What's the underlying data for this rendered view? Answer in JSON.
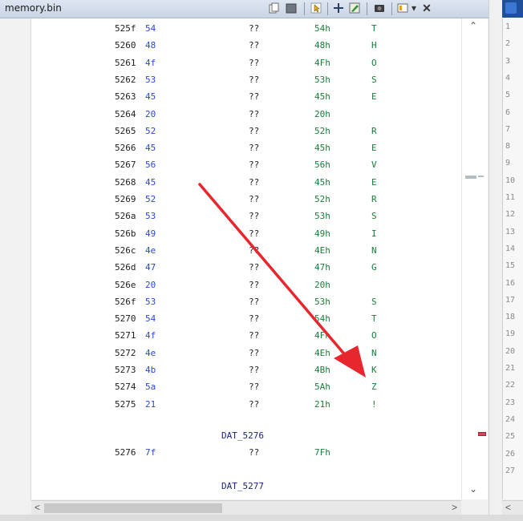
{
  "window": {
    "title": "memory.bin"
  },
  "toolbar": {
    "icons": [
      "copy-icon",
      "paste-icon",
      "cursor-icon",
      "split-icon",
      "edit-icon",
      "snapshot-icon",
      "options-dropdown-icon",
      "close-icon"
    ],
    "close_label": "✕",
    "dropdown_label": "▾"
  },
  "listing": {
    "rows": [
      {
        "addr": "525f",
        "byte": "54",
        "mnemonic": "??",
        "value": "54h",
        "char": "T"
      },
      {
        "addr": "5260",
        "byte": "48",
        "mnemonic": "??",
        "value": "48h",
        "char": "H"
      },
      {
        "addr": "5261",
        "byte": "4f",
        "mnemonic": "??",
        "value": "4Fh",
        "char": "O"
      },
      {
        "addr": "5262",
        "byte": "53",
        "mnemonic": "??",
        "value": "53h",
        "char": "S"
      },
      {
        "addr": "5263",
        "byte": "45",
        "mnemonic": "??",
        "value": "45h",
        "char": "E"
      },
      {
        "addr": "5264",
        "byte": "20",
        "mnemonic": "??",
        "value": "20h",
        "char": ""
      },
      {
        "addr": "5265",
        "byte": "52",
        "mnemonic": "??",
        "value": "52h",
        "char": "R"
      },
      {
        "addr": "5266",
        "byte": "45",
        "mnemonic": "??",
        "value": "45h",
        "char": "E"
      },
      {
        "addr": "5267",
        "byte": "56",
        "mnemonic": "??",
        "value": "56h",
        "char": "V"
      },
      {
        "addr": "5268",
        "byte": "45",
        "mnemonic": "??",
        "value": "45h",
        "char": "E"
      },
      {
        "addr": "5269",
        "byte": "52",
        "mnemonic": "??",
        "value": "52h",
        "char": "R"
      },
      {
        "addr": "526a",
        "byte": "53",
        "mnemonic": "??",
        "value": "53h",
        "char": "S"
      },
      {
        "addr": "526b",
        "byte": "49",
        "mnemonic": "??",
        "value": "49h",
        "char": "I"
      },
      {
        "addr": "526c",
        "byte": "4e",
        "mnemonic": "??",
        "value": "4Eh",
        "char": "N"
      },
      {
        "addr": "526d",
        "byte": "47",
        "mnemonic": "??",
        "value": "47h",
        "char": "G"
      },
      {
        "addr": "526e",
        "byte": "20",
        "mnemonic": "??",
        "value": "20h",
        "char": ""
      },
      {
        "addr": "526f",
        "byte": "53",
        "mnemonic": "??",
        "value": "53h",
        "char": "S"
      },
      {
        "addr": "5270",
        "byte": "54",
        "mnemonic": "??",
        "value": "54h",
        "char": "T"
      },
      {
        "addr": "5271",
        "byte": "4f",
        "mnemonic": "??",
        "value": "4Fh",
        "char": "O"
      },
      {
        "addr": "5272",
        "byte": "4e",
        "mnemonic": "??",
        "value": "4Eh",
        "char": "N"
      },
      {
        "addr": "5273",
        "byte": "4b",
        "mnemonic": "??",
        "value": "4Bh",
        "char": "K"
      },
      {
        "addr": "5274",
        "byte": "5a",
        "mnemonic": "??",
        "value": "5Ah",
        "char": "Z"
      },
      {
        "addr": "5275",
        "byte": "21",
        "mnemonic": "??",
        "value": "21h",
        "char": "!"
      }
    ],
    "label_1": "DAT_5276",
    "row_5276": {
      "addr": "5276",
      "byte": "7f",
      "mnemonic": "??",
      "value": "7Fh"
    },
    "label_2": "DAT_5277"
  },
  "line_numbers": [
    "1",
    "2",
    "3",
    "4",
    "5",
    "6",
    "7",
    "8",
    "9",
    "10",
    "11",
    "12",
    "13",
    "14",
    "15",
    "16",
    "17",
    "18",
    "19",
    "20",
    "21",
    "22",
    "23",
    "24",
    "25",
    "26",
    "27"
  ],
  "scroll": {
    "up": "⌃",
    "down": "⌄",
    "left": "<",
    "right": ">"
  },
  "colors": {
    "byte": "#2c48d6",
    "value": "#1b7d3a",
    "label": "#1a237e",
    "arrow": "#e8262d"
  }
}
